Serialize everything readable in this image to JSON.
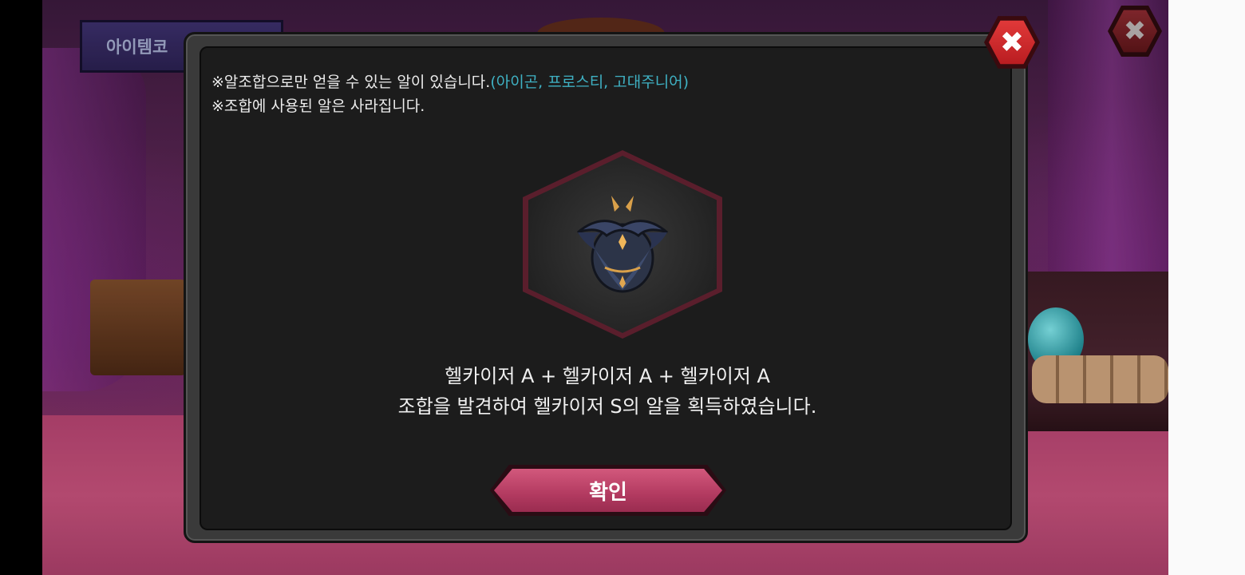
{
  "background": {
    "item_tab_label": "아이템코"
  },
  "modal": {
    "notice_line1_prefix": "※알조합으로만 얻을 수 있는 알이 있습니다.",
    "notice_line1_highlight": "(아이곤, 프로스티, 고대주니어)",
    "notice_line2": "※조합에 사용된 알은 사라집니다.",
    "egg_icon": "helkaiser-egg-icon",
    "result_line1": "헬카이저 A + 헬카이저 A + 헬카이저 A",
    "result_line2": "조합을 발견하여 헬카이저 S의 알을 획득하였습니다.",
    "confirm_label": "확인",
    "close_icon": "close-icon"
  },
  "colors": {
    "highlight": "#3fb2c4",
    "confirm_button": "#c0466c",
    "close_button": "#d42a2e"
  }
}
